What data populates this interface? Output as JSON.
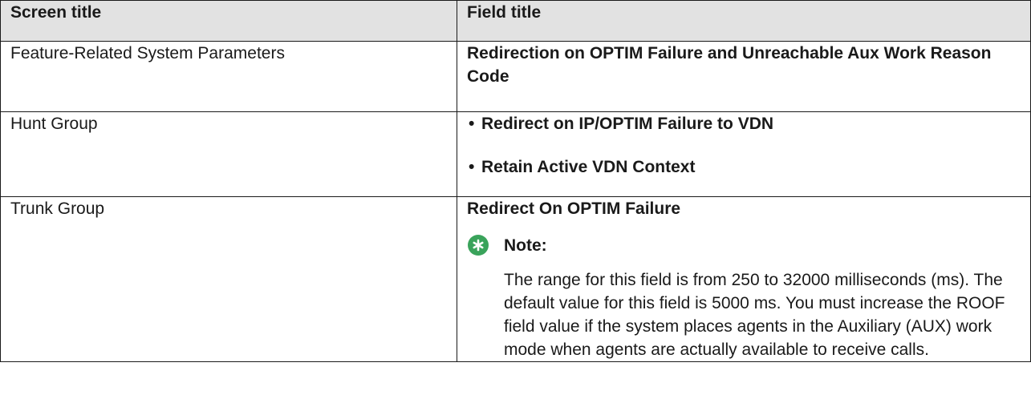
{
  "table": {
    "headers": {
      "screen_title": "Screen title",
      "field_title": "Field title"
    },
    "rows": [
      {
        "screen": "Feature-Related System Parameters",
        "field": "Redirection on OPTIM Failure and Unreachable Aux Work Reason Code"
      },
      {
        "screen": "Hunt Group",
        "bullets": [
          "Redirect on IP/OPTIM Failure to VDN",
          "Retain Active VDN Context"
        ],
        "bullet_char": "•"
      },
      {
        "screen": "Trunk Group",
        "field": "Redirect On OPTIM Failure",
        "note": {
          "icon": "asterisk-icon",
          "label": "Note:",
          "text": "The range for this field is from 250 to 32000 milliseconds (ms). The default value for this field is 5000 ms. You must increase the ROOF field value if the system places agents in the Auxiliary (AUX) work mode when agents are actually available to receive calls."
        }
      }
    ]
  },
  "colors": {
    "header_bg": "#e2e2e2",
    "note_icon": "#3aa35b",
    "border": "#1a1a1a"
  }
}
